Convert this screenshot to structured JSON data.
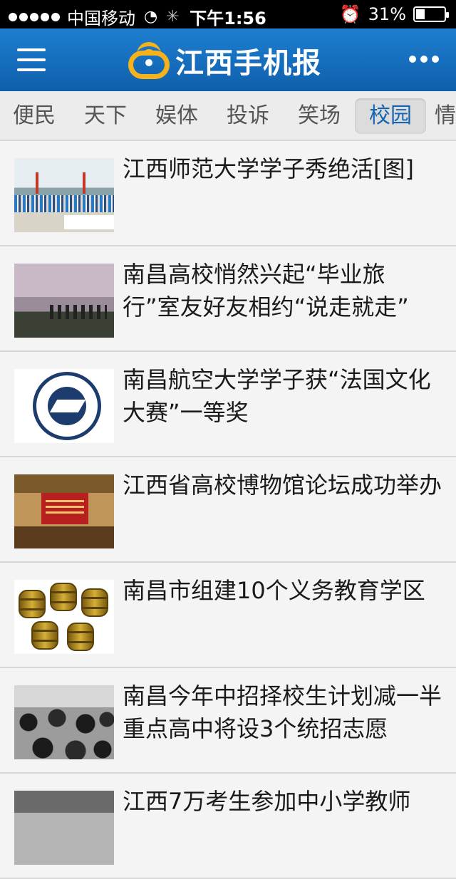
{
  "status_bar": {
    "carrier": "中国移动",
    "time": "下午1:56",
    "battery": "31%",
    "battery_level": 0.31
  },
  "header": {
    "logo_text": "江西手机报",
    "logo_icon": "logo-icon",
    "menu_icon": "menu-icon",
    "more_icon": "more-icon"
  },
  "tabs": [
    {
      "label": "便民",
      "active": false
    },
    {
      "label": "天下",
      "active": false
    },
    {
      "label": "娱体",
      "active": false
    },
    {
      "label": "投诉",
      "active": false
    },
    {
      "label": "笑场",
      "active": false
    },
    {
      "label": "校园",
      "active": true
    },
    {
      "label": "情",
      "active": false
    }
  ],
  "articles": [
    {
      "title": "江西师范大学学子秀绝活[图]"
    },
    {
      "title": "南昌高校悄然兴起“毕业旅行”室友好友相约“说走就走”"
    },
    {
      "title": "南昌航空大学学子获“法国文化大赛”一等奖"
    },
    {
      "title": "江西省高校博物馆论坛成功举办"
    },
    {
      "title": "南昌市组建10个义务教育学区"
    },
    {
      "title": "南昌今年中招择校生计划减一半 重点高中将设3个统招志愿"
    },
    {
      "title": "江西7万考生参加中小学教师"
    }
  ],
  "colors": {
    "nav_bar": "#1565b0",
    "logo_accent": "#f6b21a",
    "active_tab_text": "#1565b0"
  }
}
